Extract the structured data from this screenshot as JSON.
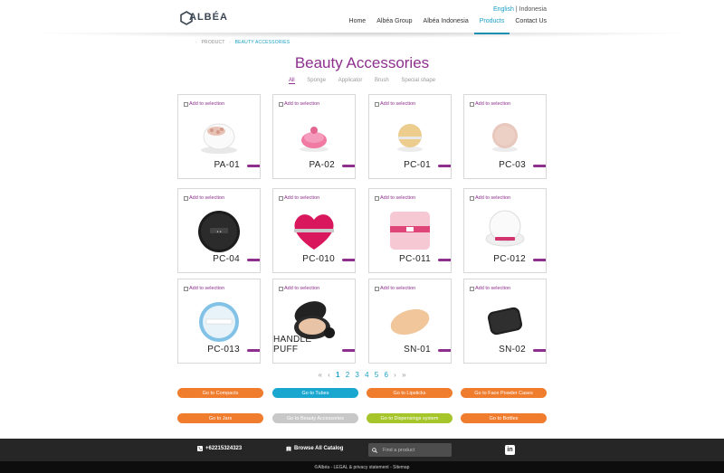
{
  "header": {
    "logo_text": "ALBÉA",
    "lang_english": "English",
    "lang_separator": "|",
    "lang_indonesia": "Indonesia",
    "nav": [
      {
        "label": "Home"
      },
      {
        "label": "Albéa Group"
      },
      {
        "label": "Albéa Indonesia"
      },
      {
        "label": "Products"
      },
      {
        "label": "Contact Us"
      }
    ]
  },
  "breadcrumb": {
    "root": "PRODUCT",
    "current": "BEAUTY ACCESSORIES"
  },
  "page_title": "Beauty Accessories",
  "filters": [
    {
      "label": "All"
    },
    {
      "label": "Sponge"
    },
    {
      "label": "Applicator"
    },
    {
      "label": "Brush"
    },
    {
      "label": "Special shape"
    }
  ],
  "add_label": "Add to selection",
  "products": [
    {
      "code": "PA-01"
    },
    {
      "code": "PA-02"
    },
    {
      "code": "PC-01"
    },
    {
      "code": "PC-03"
    },
    {
      "code": "PC-04"
    },
    {
      "code": "PC-010"
    },
    {
      "code": "PC-011"
    },
    {
      "code": "PC-012"
    },
    {
      "code": "PC-013"
    },
    {
      "code": "HANDLE PUFF"
    },
    {
      "code": "SN-01"
    },
    {
      "code": "SN-02"
    }
  ],
  "pagination": {
    "first": "«",
    "prev": "‹",
    "pages": [
      "1",
      "2",
      "3",
      "4",
      "5",
      "6"
    ],
    "next": "›",
    "last": "»",
    "current_page": "1"
  },
  "category_buttons": [
    {
      "label": "Go to Compacts",
      "color": "#f07c2e"
    },
    {
      "label": "Go to Tubes",
      "color": "#1aa7cf"
    },
    {
      "label": "Go to Lipsticks",
      "color": "#f07c2e"
    },
    {
      "label": "Go to Face Powder Cases",
      "color": "#f07c2e"
    },
    {
      "label": "Go to Jars",
      "color": "#f07c2e"
    },
    {
      "label": "Go to Beauty Accessories",
      "color": "#c8c8c8"
    },
    {
      "label": "Go to Dispensings system",
      "color": "#a5c52a"
    },
    {
      "label": "Go to Bottles",
      "color": "#f07c2e"
    }
  ],
  "footer": {
    "phone": "+62215324323",
    "catalog": "Browse All Catalog",
    "search_placeholder": "Find a product",
    "linkedin": "in",
    "legal": "©Albéa - LEGAL & privacy statement - Sitemap"
  },
  "colors": {
    "accent": "#8e2f8e",
    "link": "#1a9fc4",
    "footer": "#262626"
  }
}
